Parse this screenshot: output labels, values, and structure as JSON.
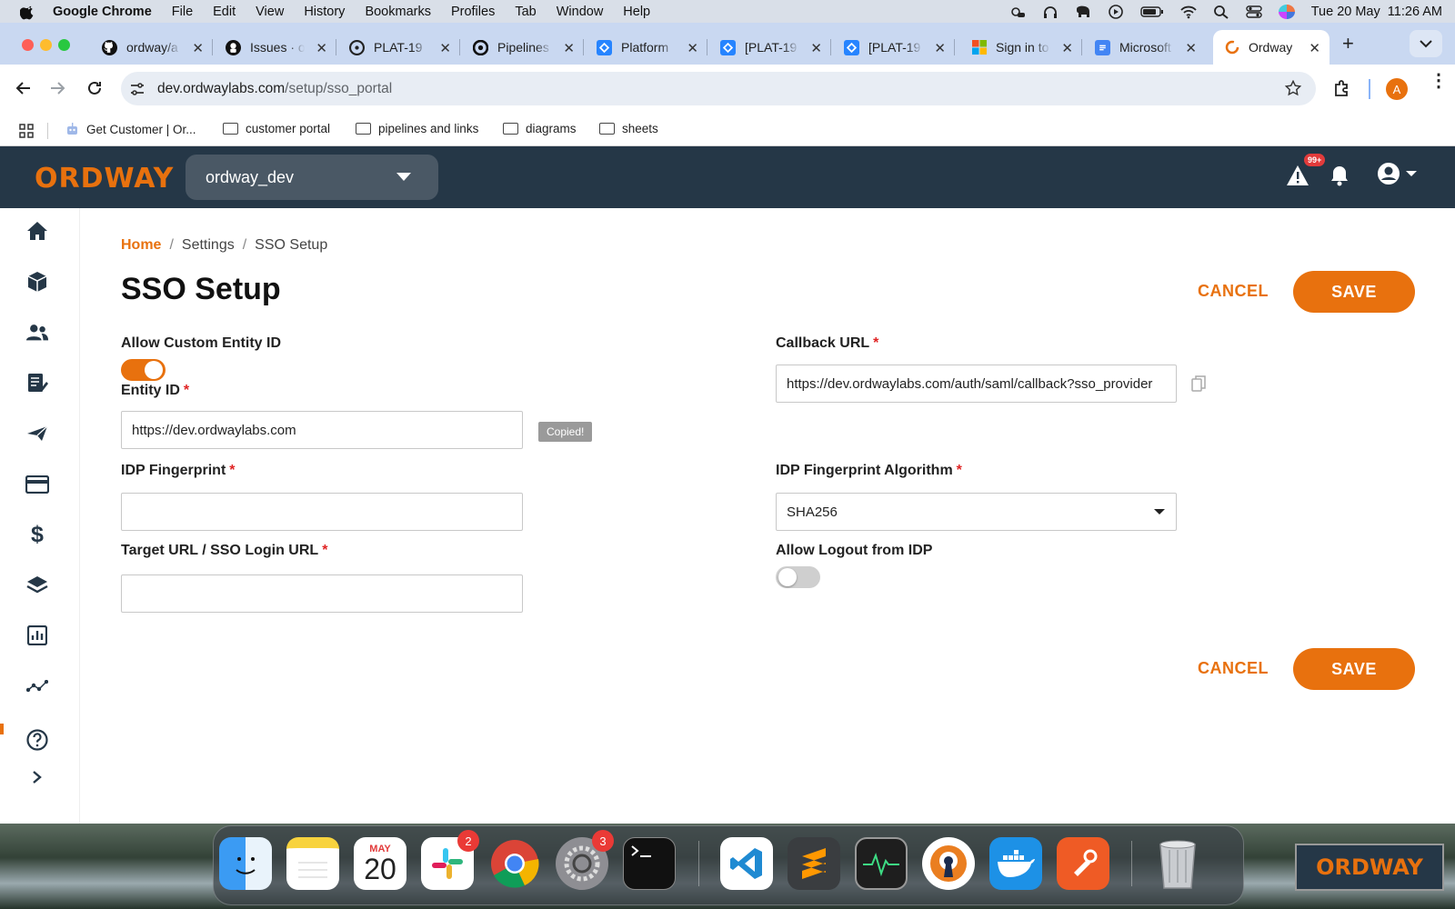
{
  "menubar": {
    "app": "Google Chrome",
    "items": [
      "File",
      "Edit",
      "View",
      "History",
      "Bookmarks",
      "Profiles",
      "Tab",
      "Window",
      "Help"
    ],
    "clock": "Tue 20 May  11:26 AM"
  },
  "tabs": [
    {
      "title": "ordway/a",
      "icon": "github-icon"
    },
    {
      "title": "Issues · o",
      "icon": "github-icon"
    },
    {
      "title": "PLAT-19",
      "icon": "github-icon"
    },
    {
      "title": "Pipelines",
      "icon": "circleci-icon"
    },
    {
      "title": "Platform",
      "icon": "jira-icon"
    },
    {
      "title": "[PLAT-19",
      "icon": "jira-icon"
    },
    {
      "title": "[PLAT-19",
      "icon": "jira-icon"
    },
    {
      "title": "Sign in to",
      "icon": "microsoft-icon"
    },
    {
      "title": "Microsoft",
      "icon": "docs-icon"
    },
    {
      "title": "Ordway",
      "icon": "ordway-icon",
      "active": true
    }
  ],
  "address": {
    "host": "dev.ordwaylabs.com",
    "path": "/setup/sso_portal"
  },
  "profile_initial": "A",
  "bookmarks": [
    {
      "label": "Get Customer | Or...",
      "icon": "bot-icon"
    },
    {
      "label": "customer portal",
      "icon": "folder-icon"
    },
    {
      "label": "pipelines and links",
      "icon": "folder-icon"
    },
    {
      "label": "diagrams",
      "icon": "folder-icon"
    },
    {
      "label": "sheets",
      "icon": "folder-icon"
    }
  ],
  "app": {
    "logo": "ORDWAY",
    "tenant": "ordway_dev",
    "alert_badge": "99+"
  },
  "breadcrumb": {
    "home": "Home",
    "settings": "Settings",
    "current": "SSO Setup"
  },
  "page_title": "SSO Setup",
  "actions": {
    "cancel": "CANCEL",
    "save": "SAVE"
  },
  "form": {
    "allow_custom_entity_id": {
      "label": "Allow Custom Entity ID",
      "on": true
    },
    "entity_id": {
      "label": "Entity ID",
      "value": "https://dev.ordwaylabs.com",
      "tooltip": "Copied!"
    },
    "callback_url": {
      "label": "Callback URL",
      "value": "https://dev.ordwaylabs.com/auth/saml/callback?sso_provider"
    },
    "idp_fingerprint": {
      "label": "IDP Fingerprint",
      "value": ""
    },
    "idp_algorithm": {
      "label": "IDP Fingerprint Algorithm",
      "value": "SHA256"
    },
    "target_url": {
      "label": "Target URL / SSO Login URL",
      "value": ""
    },
    "allow_logout": {
      "label": "Allow Logout from IDP",
      "on": false
    },
    "required_mark": "*"
  },
  "dock": {
    "calendar_month": "MAY",
    "calendar_day": "20",
    "slack_badge": "2",
    "settings_badge": "3",
    "thumb_label": "ORDWAY"
  },
  "colors": {
    "accent": "#e8710e",
    "header": "#253747",
    "required": "#e02424"
  }
}
